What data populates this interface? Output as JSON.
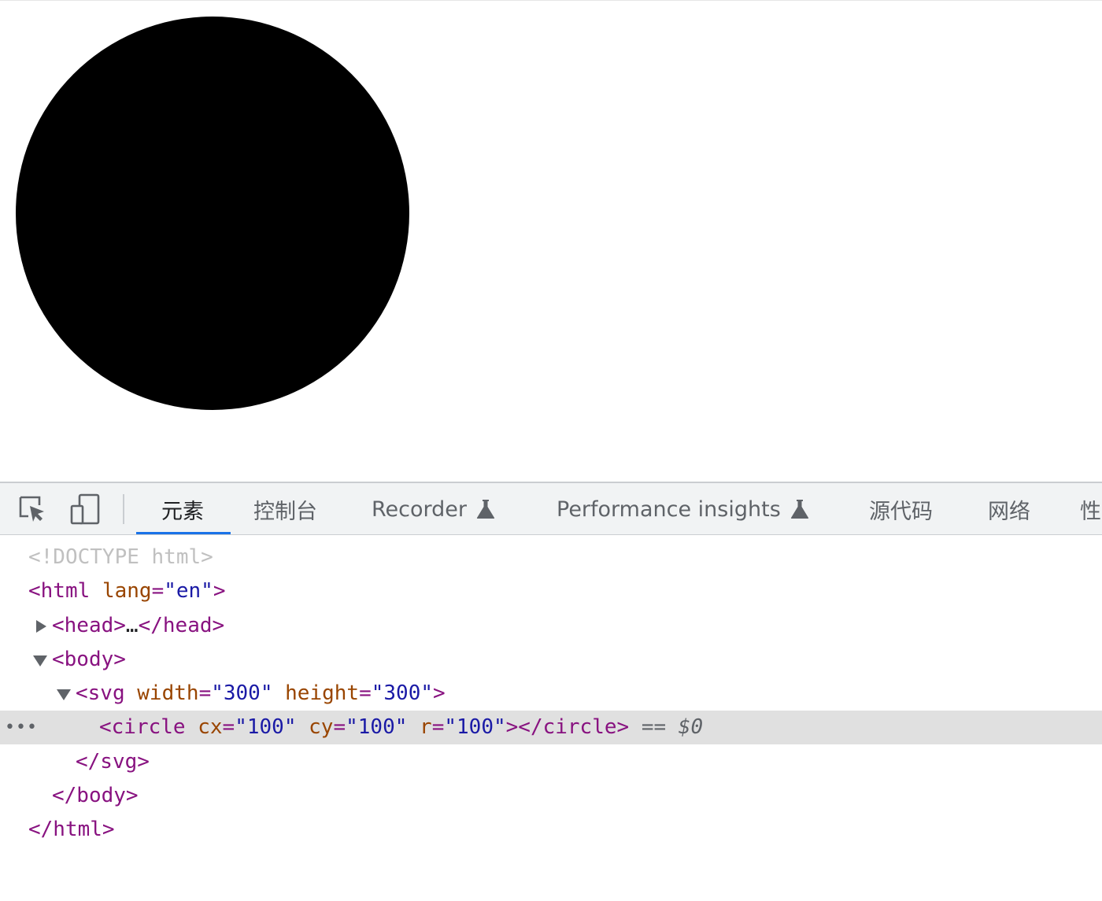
{
  "tabs": [
    {
      "label": "元素",
      "active": true
    },
    {
      "label": "控制台"
    },
    {
      "label": "Recorder",
      "experimental": true
    },
    {
      "label": "Performance insights",
      "experimental": true
    },
    {
      "label": "源代码"
    },
    {
      "label": "网络"
    },
    {
      "label": "性"
    }
  ],
  "icons": {
    "inspect": "inspect-element-icon",
    "device": "device-toolbar-icon",
    "flask": "experimental-flask-icon"
  },
  "colors": {
    "tag": "#881280",
    "attr": "#994500",
    "value": "#1a1aa6",
    "active_tab_underline": "#1a73e8",
    "selected_row": "#e0e0e0"
  },
  "dom": {
    "doctype": "<!DOCTYPE html>",
    "html_open": "<html",
    "html_attr": "lang",
    "html_attr_val": "\"en\"",
    "head_open": "<head>",
    "head_ellipsis": "…",
    "head_close": "</head>",
    "body_open": "<body>",
    "svg_open": "<svg",
    "svg_width_attr": "width",
    "svg_width_val": "\"300\"",
    "svg_height_attr": "height",
    "svg_height_val": "\"300\"",
    "circle_open": "<circle",
    "circle_cx_attr": "cx",
    "circle_cx_val": "\"100\"",
    "circle_cy_attr": "cy",
    "circle_cy_val": "\"100\"",
    "circle_r_attr": "r",
    "circle_r_val": "\"100\"",
    "circle_close": "></circle>",
    "selected_marker": "== $0",
    "svg_close": "</svg>",
    "body_close": "</body>",
    "html_close": "</html>",
    "row_menu": "•••"
  }
}
